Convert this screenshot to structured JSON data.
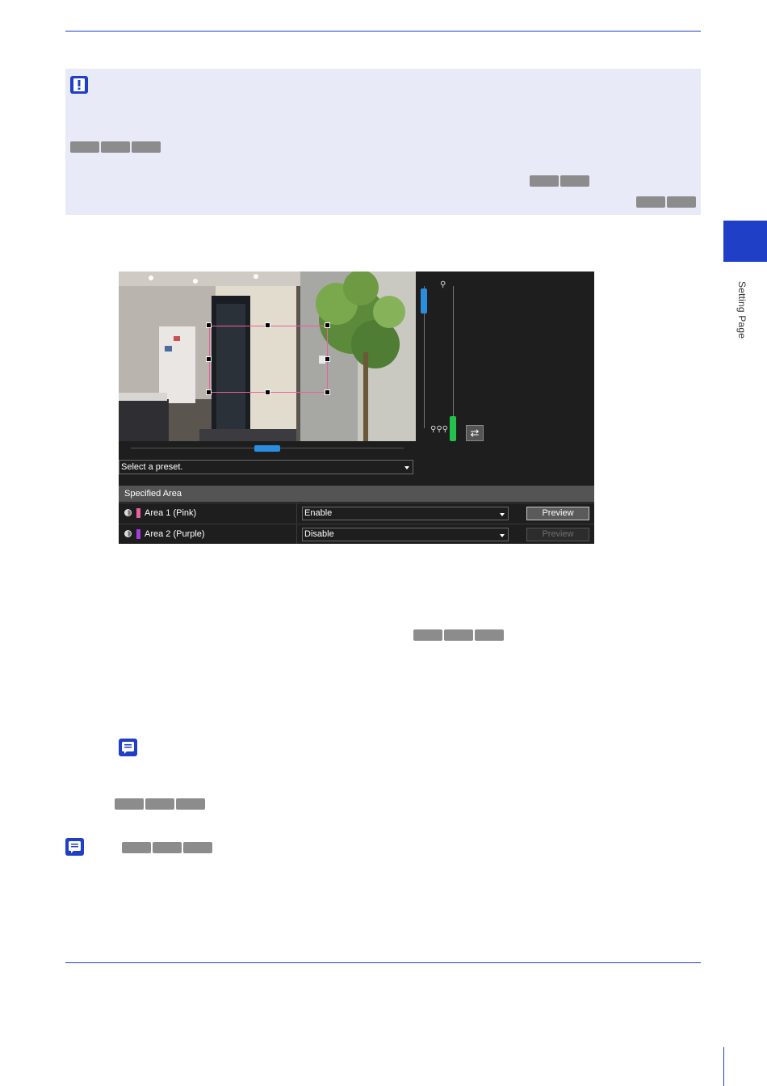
{
  "side_tab": {
    "label": "Setting Page"
  },
  "camera_ui": {
    "preset_select": {
      "value": "Select a preset."
    },
    "specified_area": {
      "header": "Specified Area",
      "rows": [
        {
          "name": "Area 1 (Pink)",
          "color": "#ec5fa0",
          "setting": "Enable",
          "preview_label": "Preview",
          "preview_enabled": true
        },
        {
          "name": "Area 2 (Purple)",
          "color": "#a23ee0",
          "setting": "Disable",
          "preview_label": "Preview",
          "preview_enabled": false
        }
      ]
    }
  },
  "icons": {
    "important": "important-icon",
    "note": "note-icon",
    "swap": "swap-icon",
    "focus_near": "focus-near-icon",
    "focus_far": "focus-far-icon",
    "mask": "mask-icon"
  },
  "colors": {
    "accent": "#1f3fc7",
    "important_bg": "#e8ebf7",
    "chip": "#8c8c8c"
  }
}
